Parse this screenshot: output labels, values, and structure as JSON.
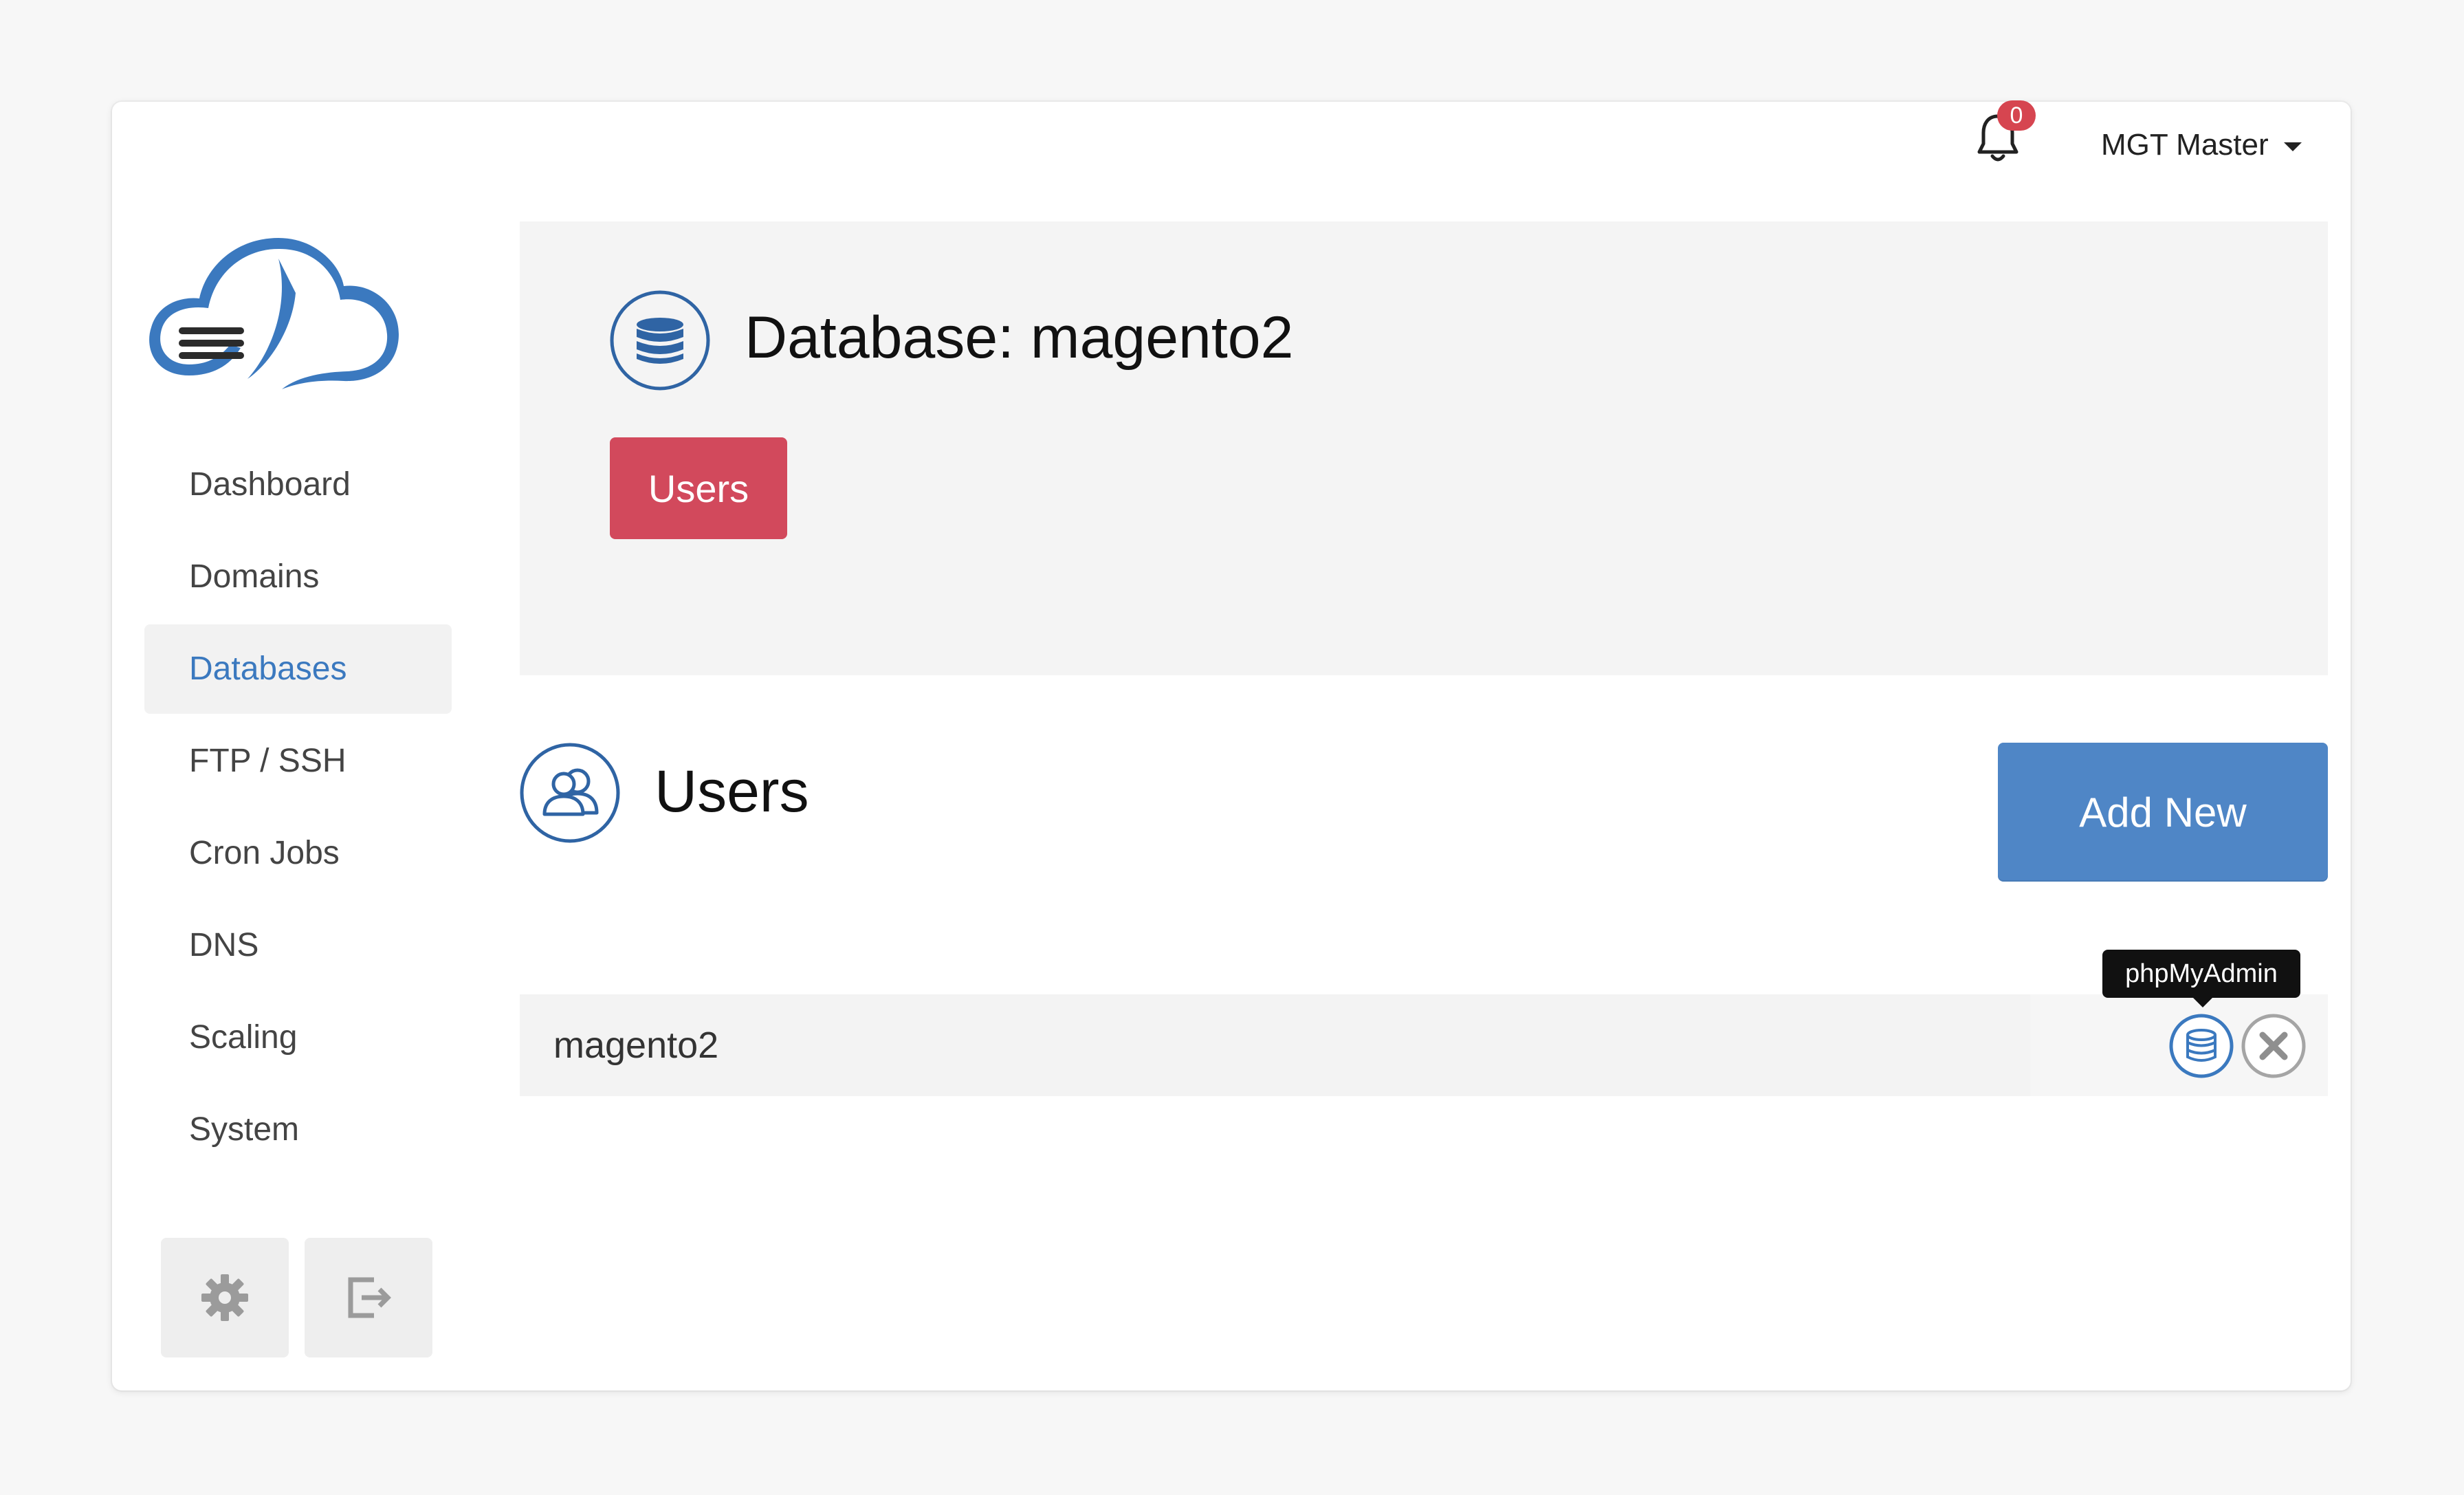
{
  "header": {
    "notification_count": "0",
    "user_name": "MGT Master"
  },
  "sidebar": {
    "items": [
      {
        "label": "Dashboard"
      },
      {
        "label": "Domains"
      },
      {
        "label": "Databases",
        "active": true
      },
      {
        "label": "FTP / SSH"
      },
      {
        "label": "Cron Jobs"
      },
      {
        "label": "DNS"
      },
      {
        "label": "Scaling"
      },
      {
        "label": "System"
      }
    ],
    "bottom_buttons": [
      {
        "icon": "gear-icon"
      },
      {
        "icon": "logout-icon"
      }
    ]
  },
  "database": {
    "title": "Database: magento2",
    "users_tab_label": "Users"
  },
  "users_section": {
    "title": "Users",
    "add_new_label": "Add New",
    "rows": [
      {
        "name": "magento2"
      }
    ],
    "tooltip": "phpMyAdmin"
  },
  "colors": {
    "brand_blue": "#3b79bf",
    "danger": "#d2495c",
    "primary_button": "#4f86c6"
  }
}
